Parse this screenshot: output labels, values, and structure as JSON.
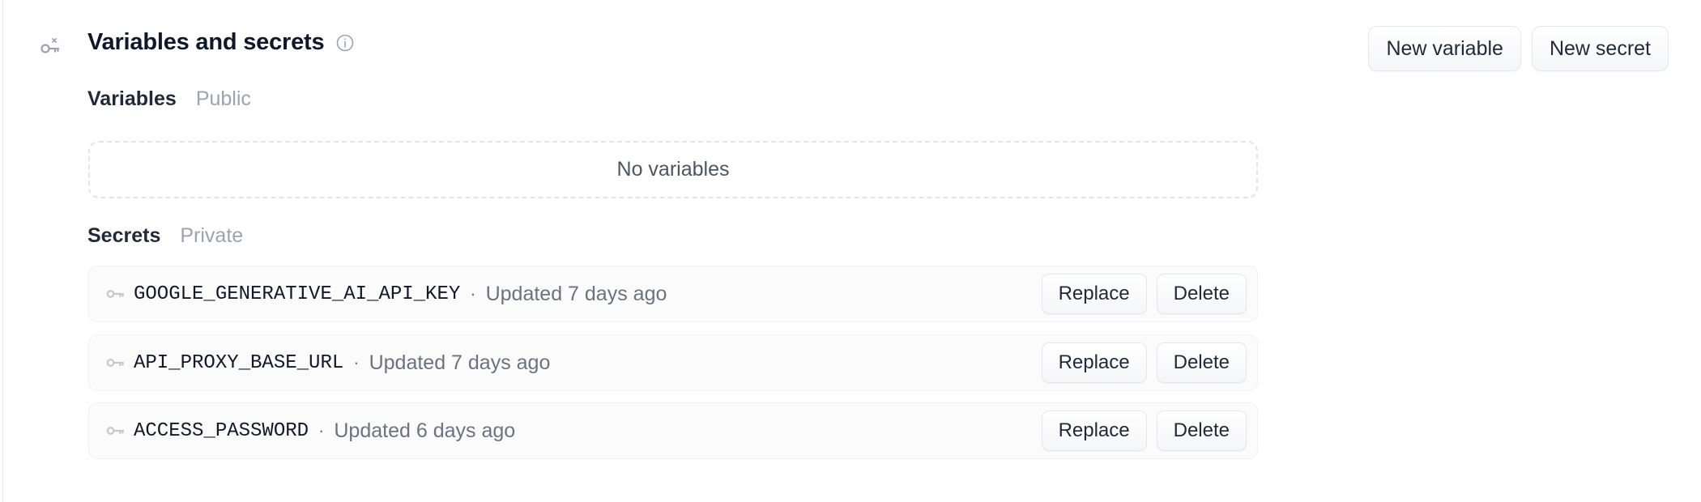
{
  "header": {
    "title": "Variables and secrets",
    "section_icon": "key-settings-icon",
    "info_icon": "info-icon"
  },
  "actions": {
    "new_variable_label": "New variable",
    "new_secret_label": "New secret"
  },
  "variables": {
    "title": "Variables",
    "visibility": "Public",
    "empty_text": "No variables"
  },
  "secrets": {
    "title": "Secrets",
    "visibility": "Private",
    "separator": "·",
    "items": [
      {
        "name": "GOOGLE_GENERATIVE_AI_API_KEY",
        "updated": "Updated 7 days ago",
        "replace_label": "Replace",
        "delete_label": "Delete"
      },
      {
        "name": "API_PROXY_BASE_URL",
        "updated": "Updated 7 days ago",
        "replace_label": "Replace",
        "delete_label": "Delete"
      },
      {
        "name": "ACCESS_PASSWORD",
        "updated": "Updated 6 days ago",
        "replace_label": "Replace",
        "delete_label": "Delete"
      }
    ]
  },
  "colors": {
    "text_primary": "#0f172a",
    "text_muted": "#6b7280",
    "text_faint": "#9ca3af",
    "border": "#e5e7eb"
  }
}
